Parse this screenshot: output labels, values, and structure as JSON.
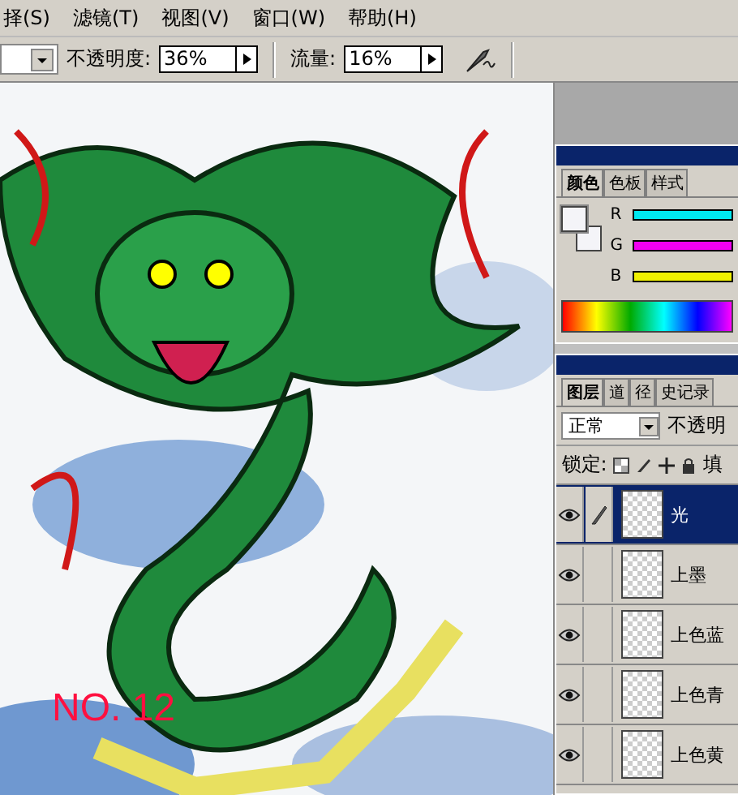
{
  "menu": [
    {
      "label": "择(S)"
    },
    {
      "label": "滤镜(T)"
    },
    {
      "label": "视图(V)"
    },
    {
      "label": "窗口(W)"
    },
    {
      "label": "帮助(H)"
    }
  ],
  "toolbar": {
    "opacity_label": "不透明度:",
    "opacity": "36%",
    "flow_label": "流量:",
    "flow": "16%"
  },
  "artwork": {
    "caption": "NO. 12"
  },
  "color_panel": {
    "tabs": [
      {
        "label": "颜色",
        "selected": true
      },
      {
        "label": "色板",
        "selected": false
      },
      {
        "label": "样式",
        "selected": false
      }
    ],
    "channels": [
      {
        "label": "R",
        "color": "#00e8f0"
      },
      {
        "label": "G",
        "color": "#f000f0"
      },
      {
        "label": "B",
        "color": "#f0f000"
      }
    ]
  },
  "layers_panel": {
    "tabs": [
      {
        "label": "图层",
        "selected": true
      },
      {
        "label": "道",
        "selected": false
      },
      {
        "label": "径",
        "selected": false
      },
      {
        "label": "史记录",
        "selected": false
      }
    ],
    "blend_mode": "正常",
    "opacity_label": "不透明",
    "lock_label": "锁定:",
    "fill_label": "填",
    "layers": [
      {
        "name": "光",
        "selected": true,
        "visible": true
      },
      {
        "name": "上墨",
        "selected": false,
        "visible": true
      },
      {
        "name": "上色蓝",
        "selected": false,
        "visible": true
      },
      {
        "name": "上色青",
        "selected": false,
        "visible": true
      },
      {
        "name": "上色黄",
        "selected": false,
        "visible": true
      }
    ]
  }
}
